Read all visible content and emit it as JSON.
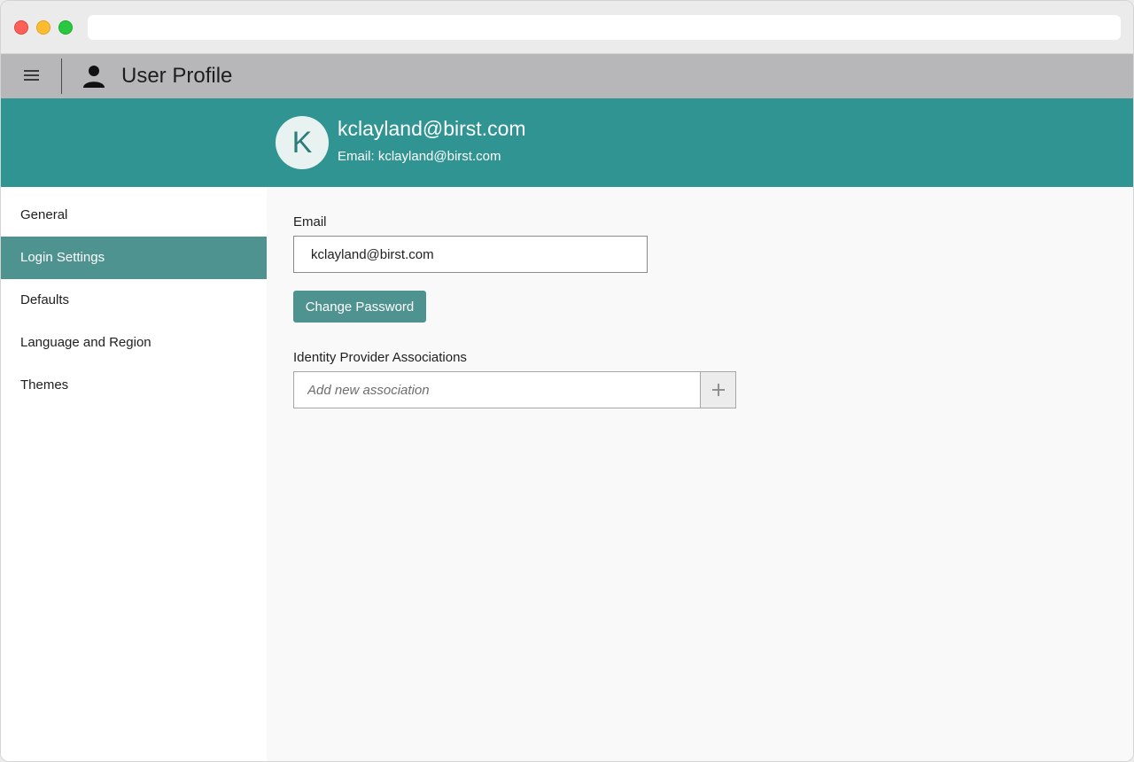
{
  "app": {
    "title": "User Profile"
  },
  "profile": {
    "avatar_initial": "K",
    "name": "kclayland@birst.com",
    "email_line": "Email: kclayland@birst.com"
  },
  "sidebar": {
    "items": [
      {
        "label": "General",
        "active": false
      },
      {
        "label": "Login Settings",
        "active": true
      },
      {
        "label": "Defaults",
        "active": false
      },
      {
        "label": "Language and Region",
        "active": false
      },
      {
        "label": "Themes",
        "active": false
      }
    ]
  },
  "login_settings": {
    "email_label": "Email",
    "email_value": "kclayland@birst.com",
    "change_password_label": "Change Password",
    "idp_label": "Identity Provider Associations",
    "idp_placeholder": "Add new association"
  },
  "colors": {
    "accent": "#309493",
    "button": "#4e9390",
    "header": "#b7b7b9"
  },
  "icons": {
    "menu": "hamburger-icon",
    "user": "person-icon",
    "add": "plus-icon"
  }
}
